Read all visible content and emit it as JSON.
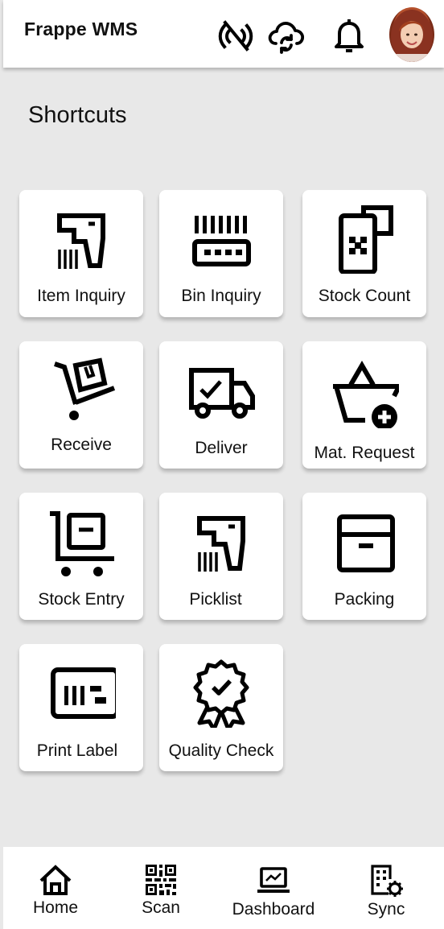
{
  "header": {
    "title": "Frappe WMS",
    "icons": [
      "no-signal-icon",
      "cloud-sync-icon",
      "bell-icon",
      "user-avatar"
    ]
  },
  "main": {
    "section_title": "Shortcuts",
    "shortcuts": [
      {
        "label": "Item Inquiry",
        "icon": "barcode-scanner-icon"
      },
      {
        "label": "Bin Inquiry",
        "icon": "bin-barcode-icon"
      },
      {
        "label": "Stock Count",
        "icon": "mobile-count-icon"
      },
      {
        "label": "Receive",
        "icon": "hand-truck-box-icon"
      },
      {
        "label": "Deliver",
        "icon": "delivery-truck-icon"
      },
      {
        "label": "Mat. Request",
        "icon": "basket-add-icon"
      },
      {
        "label": "Stock Entry",
        "icon": "cart-box-icon"
      },
      {
        "label": "Picklist",
        "icon": "barcode-scanner-icon"
      },
      {
        "label": "Packing",
        "icon": "archive-box-icon"
      },
      {
        "label": "Print Label",
        "icon": "label-printer-icon"
      },
      {
        "label": "Quality Check",
        "icon": "award-badge-icon"
      }
    ]
  },
  "bottom_nav": {
    "items": [
      {
        "label": "Home",
        "icon": "home-icon"
      },
      {
        "label": "Scan",
        "icon": "qr-code-icon"
      },
      {
        "label": "Dashboard",
        "icon": "laptop-chart-icon"
      },
      {
        "label": "Sync",
        "icon": "building-gear-icon"
      }
    ]
  }
}
